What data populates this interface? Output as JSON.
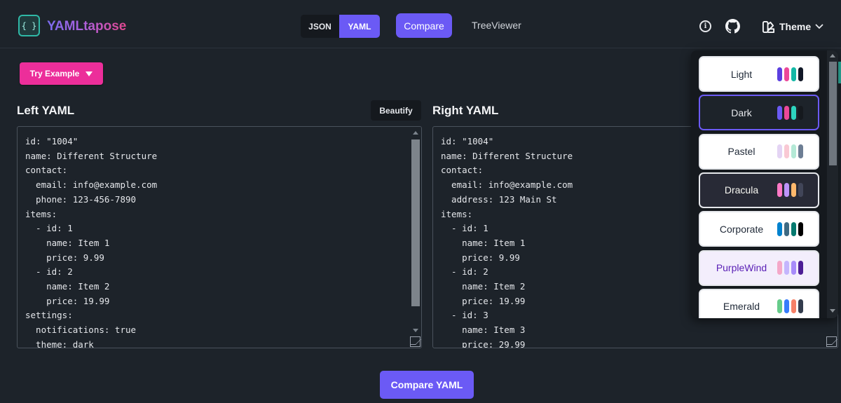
{
  "app": {
    "logo_icon": "{ }",
    "title": "YAMLtapose"
  },
  "nav": {
    "formats": [
      {
        "label": "JSON",
        "active": false
      },
      {
        "label": "YAML",
        "active": true
      }
    ],
    "compare": "Compare",
    "tree_viewer": "TreeViewer",
    "info_icon_glyph": "i",
    "theme_label": "Theme"
  },
  "controls": {
    "try_example": "Try Example",
    "beautify": "Beautify"
  },
  "left": {
    "title": "Left YAML",
    "code": "id: \"1004\"\nname: Different Structure\ncontact:\n  email: info@example.com\n  phone: 123-456-7890\nitems:\n  - id: 1\n    name: Item 1\n    price: 9.99\n  - id: 2\n    name: Item 2\n    price: 19.99\nsettings:\n  notifications: true\n  theme: dark"
  },
  "right": {
    "title": "Right YAML",
    "code": "id: \"1004\"\nname: Different Structure\ncontact:\n  email: info@example.com\n  address: 123 Main St\nitems:\n  - id: 1\n    name: Item 1\n    price: 9.99\n  - id: 2\n    name: Item 2\n    price: 19.99\n  - id: 3\n    name: Item 3\n    price: 29.99"
  },
  "compare_button": "Compare YAML",
  "themes": [
    {
      "name": "Light",
      "bg": "#ffffff",
      "fg": "#1f2937",
      "border": "#e5e7eb",
      "colors": [
        "#5b3fe0",
        "#ec4899",
        "#14b8a6",
        "#111827"
      ]
    },
    {
      "name": "Dark",
      "bg": "#1d232a",
      "fg": "#e5e7eb",
      "border": "#6b5af5",
      "colors": [
        "#6b5af5",
        "#ec4899",
        "#2dd4bf",
        "#15191e"
      ]
    },
    {
      "name": "Pastel",
      "bg": "#ffffff",
      "fg": "#1f2937",
      "border": "#e5e7eb",
      "colors": [
        "#e4d4f4",
        "#f9c9d4",
        "#b4e9d6",
        "#6d7e94"
      ]
    },
    {
      "name": "Dracula",
      "bg": "#282a36",
      "fg": "#f8f8f2",
      "border": "#e5e7eb",
      "colors": [
        "#ff79c6",
        "#bd93f9",
        "#ffb86c",
        "#414558"
      ]
    },
    {
      "name": "Corporate",
      "bg": "#ffffff",
      "fg": "#1f2937",
      "border": "#e5e7eb",
      "colors": [
        "#0082ce",
        "#3e6a83",
        "#067a6f",
        "#000000"
      ]
    },
    {
      "name": "PurpleWind",
      "bg": "#f3eefc",
      "fg": "#5b21b6",
      "border": "#e5e7eb",
      "colors": [
        "#f4a8c9",
        "#c4b5fd",
        "#a78bfa",
        "#4c1d95"
      ]
    },
    {
      "name": "Emerald",
      "bg": "#ffffff",
      "fg": "#1f2937",
      "border": "#e5e7eb",
      "colors": [
        "#66cc8a",
        "#377cfb",
        "#f68067",
        "#333c4d"
      ]
    }
  ]
}
